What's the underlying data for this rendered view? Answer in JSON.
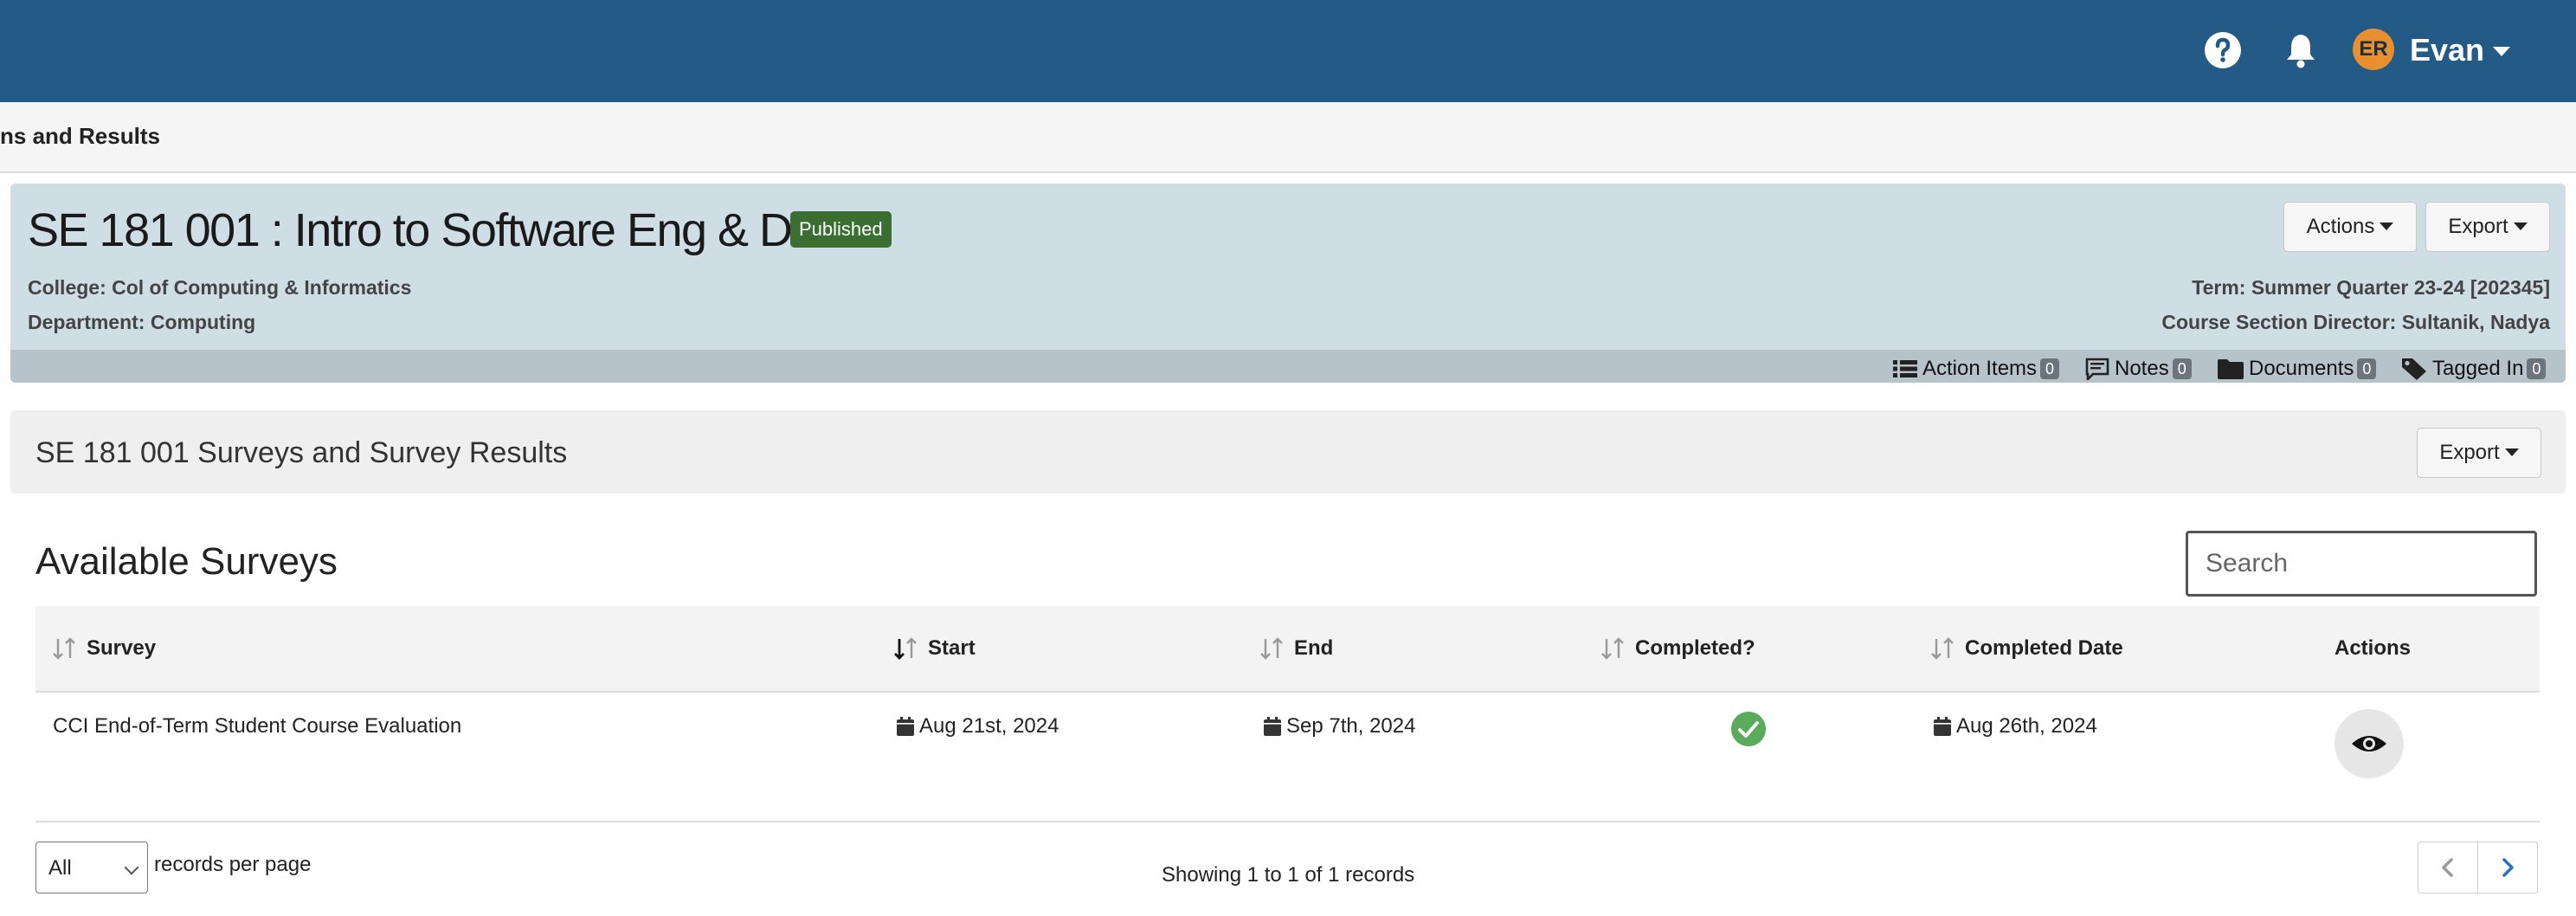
{
  "header": {
    "user": {
      "initials": "ER",
      "name": "Evan"
    },
    "icons": [
      "help-icon",
      "bell-icon"
    ],
    "colors": {
      "bar": "#235a86",
      "avatar": "#e8902f"
    }
  },
  "breadcrumb": {
    "text": "ns and Results"
  },
  "course": {
    "title": "SE 181 001 : Intro to Software Eng & Dev",
    "status": "Published",
    "college": "College: Col of Computing & Informatics",
    "department": "Department: Computing",
    "term": "Term: Summer Quarter 23-24 [202345]",
    "director": "Course Section Director: Sultanik, Nadya",
    "actions_label": "Actions",
    "export_label": "Export",
    "counters": [
      {
        "label": "Action Items",
        "count": "0",
        "icon": "list-icon"
      },
      {
        "label": "Notes",
        "count": "0",
        "icon": "notes-icon"
      },
      {
        "label": "Documents",
        "count": "0",
        "icon": "folder-icon"
      },
      {
        "label": "Tagged In",
        "count": "0",
        "icon": "tag-icon"
      }
    ]
  },
  "surveys_section": {
    "title": "SE 181 001 Surveys and Survey Results",
    "export_label": "Export"
  },
  "available": {
    "title": "Available Surveys",
    "search_placeholder": "Search",
    "columns": [
      "Survey",
      "Start",
      "End",
      "Completed?",
      "Completed Date",
      "Actions"
    ],
    "rows": [
      {
        "survey": "CCI End-of-Term Student Course Evaluation",
        "start": "Aug 21st, 2024",
        "end": "Sep 7th, 2024",
        "completed": true,
        "completed_date": "Aug 26th, 2024",
        "action_icon": "eye-icon"
      }
    ]
  },
  "footer": {
    "per_page_value": "All",
    "per_page_label": "records per page",
    "showing": "Showing 1 to 1 of 1 records"
  }
}
